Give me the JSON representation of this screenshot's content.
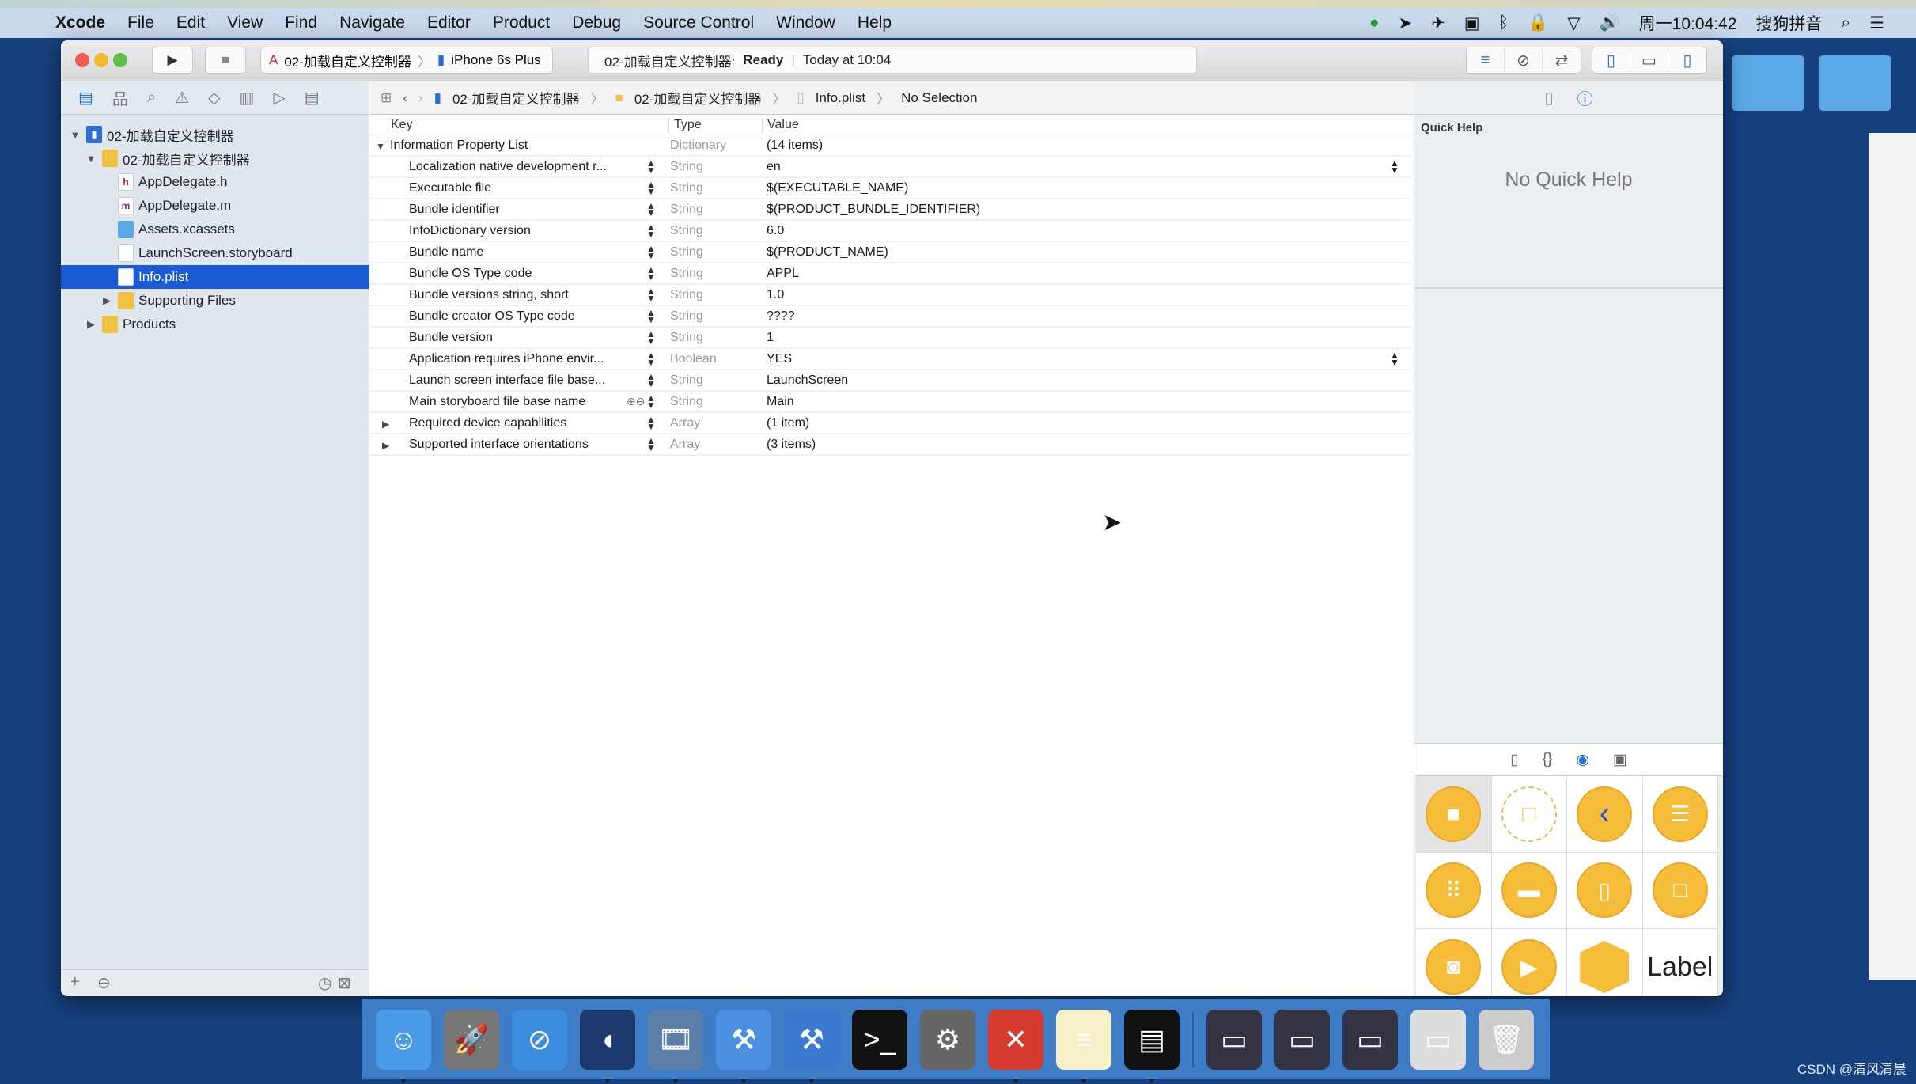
{
  "menubar": {
    "app": "Xcode",
    "items": [
      "File",
      "Edit",
      "View",
      "Find",
      "Navigate",
      "Editor",
      "Product",
      "Debug",
      "Source Control",
      "Window",
      "Help"
    ],
    "clock": "周一10:04:42",
    "input_method": "搜狗拼音"
  },
  "toolbar": {
    "scheme": "02-加载自定义控制器",
    "device": "iPhone 6s Plus",
    "activity_project": "02-加载自定义控制器:",
    "activity_status": "Ready",
    "activity_time": "Today at 10:04"
  },
  "jumpbar": {
    "items": [
      "02-加载自定义控制器",
      "02-加载自定义控制器",
      "Info.plist",
      "No Selection"
    ]
  },
  "navigator": {
    "items": [
      {
        "label": "02-加载自定义控制器",
        "kind": "project",
        "level": 0,
        "disclosure": "open"
      },
      {
        "label": "02-加载自定义控制器",
        "kind": "folder",
        "level": 1,
        "disclosure": "open"
      },
      {
        "label": "AppDelegate.h",
        "kind": "h",
        "level": 2
      },
      {
        "label": "AppDelegate.m",
        "kind": "m",
        "level": 2
      },
      {
        "label": "Assets.xcassets",
        "kind": "assets",
        "level": 2
      },
      {
        "label": "LaunchScreen.storyboard",
        "kind": "storyboard",
        "level": 2
      },
      {
        "label": "Info.plist",
        "kind": "plist",
        "level": 2,
        "selected": true
      },
      {
        "label": "Supporting Files",
        "kind": "folder",
        "level": 2,
        "disclosure": "closed"
      },
      {
        "label": "Products",
        "kind": "folder",
        "level": 1,
        "disclosure": "closed"
      }
    ]
  },
  "plist": {
    "headers": {
      "key": "Key",
      "type": "Type",
      "value": "Value"
    },
    "rows": [
      {
        "key": "Information Property List",
        "type": "Dictionary",
        "value": "(14 items)",
        "root": true,
        "disclosure": "open"
      },
      {
        "key": "Localization native development r...",
        "type": "String",
        "value": "en",
        "popup": true
      },
      {
        "key": "Executable file",
        "type": "String",
        "value": "$(EXECUTABLE_NAME)"
      },
      {
        "key": "Bundle identifier",
        "type": "String",
        "value": "$(PRODUCT_BUNDLE_IDENTIFIER)"
      },
      {
        "key": "InfoDictionary version",
        "type": "String",
        "value": "6.0"
      },
      {
        "key": "Bundle name",
        "type": "String",
        "value": "$(PRODUCT_NAME)"
      },
      {
        "key": "Bundle OS Type code",
        "type": "String",
        "value": "APPL"
      },
      {
        "key": "Bundle versions string, short",
        "type": "String",
        "value": "1.0"
      },
      {
        "key": "Bundle creator OS Type code",
        "type": "String",
        "value": "????"
      },
      {
        "key": "Bundle version",
        "type": "String",
        "value": "1"
      },
      {
        "key": "Application requires iPhone envir...",
        "type": "Boolean",
        "value": "YES",
        "popup": true
      },
      {
        "key": "Launch screen interface file base...",
        "type": "String",
        "value": "LaunchScreen"
      },
      {
        "key": "Main storyboard file base name",
        "type": "String",
        "value": "Main",
        "hover": true
      },
      {
        "key": "Required device capabilities",
        "type": "Array",
        "value": "(1 item)",
        "disclosure": "closed"
      },
      {
        "key": "Supported interface orientations",
        "type": "Array",
        "value": "(3 items)",
        "disclosure": "closed"
      }
    ]
  },
  "inspector": {
    "quick_help_title": "Quick Help",
    "quick_help_empty": "No Quick Help",
    "library_label_item": "Label"
  },
  "dock": {
    "apps": [
      "Finder",
      "Launchpad",
      "Safari",
      "Mouse",
      "Photo Booth",
      "Xcode",
      "Instruments",
      "Terminal",
      "System Preferences",
      "XMind",
      "Notes",
      "Console",
      "Window 1",
      "Window 2",
      "Window 3",
      "Preview window",
      "Trash"
    ]
  },
  "watermark": "CSDN @清风清晨",
  "colors": {
    "selection": "#1c5bd6",
    "library_accent": "#f5bd3a",
    "desktop": "#17407e"
  }
}
